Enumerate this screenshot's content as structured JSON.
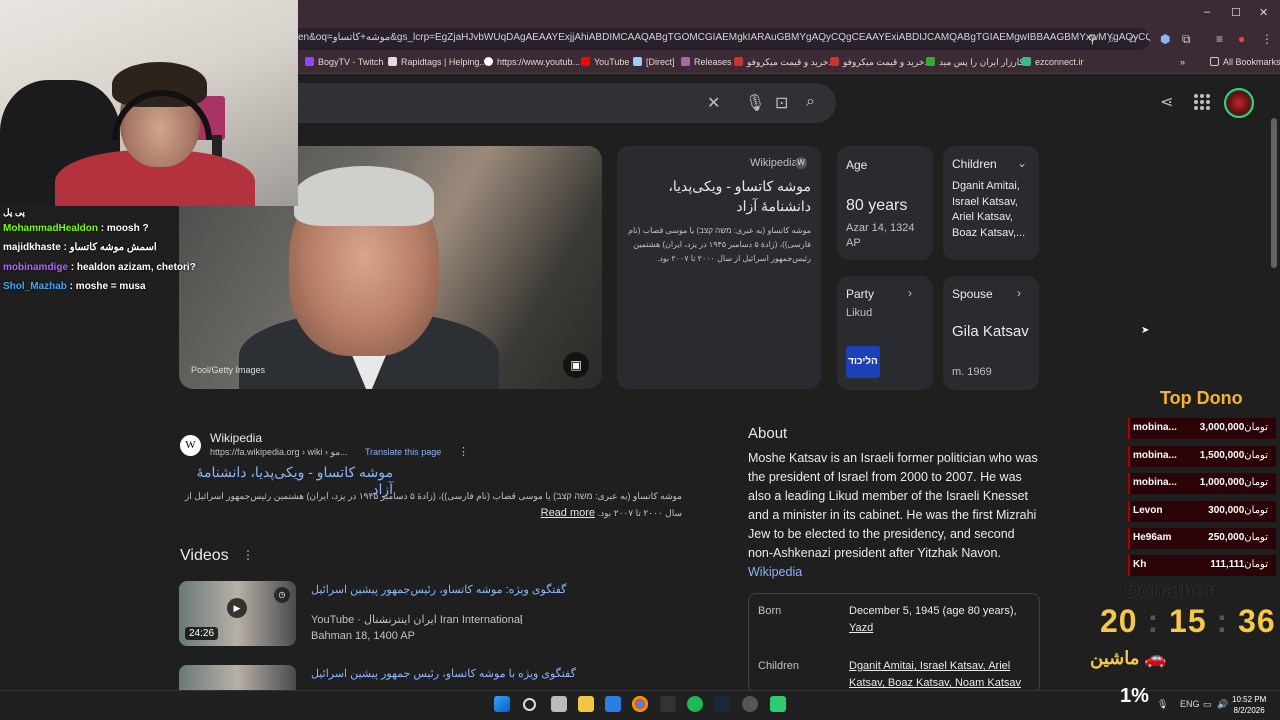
{
  "browser": {
    "url": "en&oq=موشه+کاتساو&gs_lcrp=EgZjaHJvbWUqDAgAEAAYExjjAhiABDIMCAAQABgTGOMCGIAEMgkIARAuGBMYgAQyCQgCEAAYExiABDIJCAMQABgTGIAEMgwIBBAAGBMYxwMYgAQyCQgFEAAYExiABDIJ...",
    "window_controls": {
      "minimize": "–",
      "maximize": "☐",
      "close": "✕"
    },
    "bookmarks": [
      {
        "label": "BogyTV - Twitch",
        "color": "#9146ff"
      },
      {
        "label": "Rapidtags | Helping...",
        "color": "#ddd"
      },
      {
        "label": "https://www.youtub...",
        "color": "#fff"
      },
      {
        "label": "YouTube",
        "color": "#f00"
      },
      {
        "label": "[Direct]",
        "color": "#9cf"
      },
      {
        "label": "Releases",
        "color": "#a6a"
      },
      {
        "label": "خرید و قیمت میکروفو...",
        "color": "#c33"
      },
      {
        "label": "خرید و قیمت میکروفو...",
        "color": "#c33"
      },
      {
        "label": "کارزار ایران را پس مید...",
        "color": "#3a3"
      },
      {
        "label": "ezconnect.ir",
        "color": "#3b8"
      }
    ],
    "all_bookmarks": "All Bookmarks"
  },
  "image": {
    "caption": "Pool/Getty Images"
  },
  "wiki_card": {
    "source": "Wikipedia",
    "title": "موشه کاتساو - ویکی‌پدیا، دانشنامهٔ آزاد",
    "snippet": "موشه کاتساو (به عبری: משה קצב) یا موسی قصاب (نام فارسی))، (زادهٔ ۵ دسامبر ۱۹۴۵ در یزد، ایران) هشتمین رئیس‌جمهور اسرائیل از سال ۲۰۰۰ تا ۲۰۰۷ بود."
  },
  "facts": {
    "age": {
      "label": "Age",
      "value": "80 years",
      "sub": "Azar 14, 1324 AP"
    },
    "children": {
      "label": "Children",
      "value": "Dganit Amitai, Israel Katsav, Ariel Katsav, Boaz Katsav,..."
    },
    "party": {
      "label": "Party",
      "value": "Likud",
      "logo": "הליכוד"
    },
    "spouse": {
      "label": "Spouse",
      "value": "Gila Katsav",
      "sub": "m. 1969"
    }
  },
  "result": {
    "site": "Wikipedia",
    "url": "https://fa.wikipedia.org › wiki › مو...",
    "translate": "Translate this page",
    "title": "موشه کاتساو - ویکی‌پدیا، دانشنامهٔ آزاد",
    "snippet": "موشه کاتساو (به عبری: משה קצב) یا موسی قصاب (نام فارسی))، (زادهٔ ۵ دسامبر ۱۹۴۵ در یزد، ایران) هشتمین رئیس‌جمهور اسرائیل از سال ۲۰۰۰ تا ۲۰۰۷ بود.",
    "read_more": "Read more"
  },
  "videos": {
    "heading": "Videos",
    "items": [
      {
        "title": "گفتگوی ویژه: موشه کاتساو، رئیس‌جمهور پیشین اسرائیل",
        "duration": "24:26",
        "source": "YouTube · ایران اینترنشنال Iran International",
        "date": "Bahman 18, 1400 AP"
      },
      {
        "title": "گفتگوی ویژه با موشه کاتساو، رئیس جمهور پیشین اسرائیل"
      }
    ]
  },
  "about": {
    "heading": "About",
    "text": "Moshe Katsav is an Israeli former politician who was the president of Israel from 2000 to 2007. He was also a leading Likud member of the Israeli Knesset and a minister in its cabinet. He was the first Mizrahi Jew to be elected to the presidency, and second non-Ashkenazi president after Yitzhak Navon.",
    "link": "Wikipedia",
    "born_label": "Born",
    "born_value": "December 5, 1945 (age 80 years),",
    "born_place": "Yazd",
    "children_label": "Children",
    "children_value": "Dganit Amitai, Israel Katsav, Ariel Katsav, Boaz Katsav, Noam Katsav"
  },
  "chat": [
    {
      "user": "MohammadHealdon",
      "color": "#7CFC00",
      "msg": "moosh ?"
    },
    {
      "user": "majidkhaste",
      "color": "#fff",
      "msg": "اسمش موشه کاتساو"
    },
    {
      "user": "mobinamdige",
      "color": "#b266ff",
      "msg": "healdon azizam, chetori?"
    },
    {
      "user": "Shol_Mazhab",
      "color": "#3fa9f5",
      "msg": "moshe = musa"
    }
  ],
  "chat_header": "پی پل",
  "donations": {
    "heading": "Top Dono",
    "currency": "تومان",
    "rows": [
      {
        "name": "mobina...",
        "amount": "3,000,000"
      },
      {
        "name": "mobina...",
        "amount": "1,500,000"
      },
      {
        "name": "mobina...",
        "amount": "1,000,000"
      },
      {
        "name": "Levon",
        "amount": "300,000"
      },
      {
        "name": "He96am",
        "amount": "250,000"
      },
      {
        "name": "Kh",
        "amount": "111,111"
      }
    ]
  },
  "donathon": {
    "heading": "Donathon",
    "h": "20",
    "m": "15",
    "s": "36",
    "car_label": "ماشین"
  },
  "taskbar": {
    "battery": "1%",
    "time": "10:52 PM",
    "date": "8/2/2026",
    "lang": "ENG"
  }
}
